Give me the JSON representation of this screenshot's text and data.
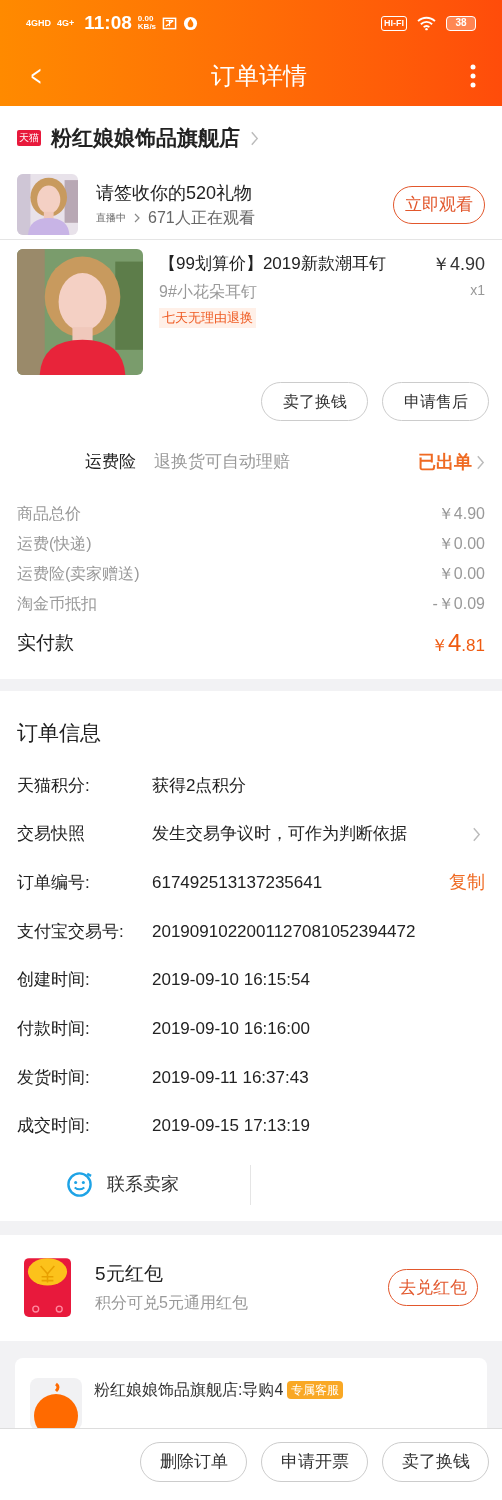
{
  "status_bar": {
    "network_1": "4GHD",
    "network_2": "4G+",
    "time": "11:08",
    "speed_value": "0.00",
    "speed_unit": "KB/s",
    "hifi": "HI-FI",
    "battery": "38"
  },
  "header": {
    "back": "<",
    "title": "订单详情"
  },
  "store": {
    "badge": "天猫",
    "name": "粉红娘娘饰品旗舰店"
  },
  "live": {
    "title": "请签收你的520礼物",
    "status": "直播中",
    "viewers": "671人正在观看",
    "button": "立即观看"
  },
  "product": {
    "title": "【99划算价】2019新款潮耳钉",
    "price": "￥4.90",
    "sku": "9#小花朵耳钉",
    "quantity": "x1",
    "tag": "七天无理由退换"
  },
  "item_actions": [
    "卖了换钱",
    "申请售后"
  ],
  "insurance": {
    "label": "运费险",
    "description": "退换货可自动理赔",
    "status": "已出单"
  },
  "costs": [
    {
      "label": "商品总价",
      "value": "￥4.90"
    },
    {
      "label": "运费(快递)",
      "value": "￥0.00"
    },
    {
      "label": "运费险(卖家赠送)",
      "value": "￥0.00"
    },
    {
      "label": "淘金币抵扣",
      "value": "-￥0.09"
    }
  ],
  "total": {
    "label": "实付款",
    "currency": "￥",
    "integer": "4",
    "decimal": ".81"
  },
  "order_info": {
    "title": "订单信息",
    "rows": [
      {
        "kind": "plain",
        "label": "天猫积分:",
        "value": "获得2点积分"
      },
      {
        "kind": "link",
        "label": "交易快照",
        "value": "发生交易争议时，可作为判断依据"
      },
      {
        "kind": "copy",
        "label": "订单编号:",
        "value": "617492513137235641",
        "action": "复制"
      },
      {
        "kind": "plain",
        "label": "支付宝交易号:",
        "value": "2019091022001127081052394472"
      },
      {
        "kind": "plain",
        "label": "创建时间:",
        "value": "2019-09-10 16:15:54"
      },
      {
        "kind": "plain",
        "label": "付款时间:",
        "value": "2019-09-10 16:16:00"
      },
      {
        "kind": "plain",
        "label": "发货时间:",
        "value": "2019-09-11 16:37:43"
      },
      {
        "kind": "plain",
        "label": "成交时间:",
        "value": "2019-09-15 17:13:19"
      }
    ],
    "contact": "联系卖家"
  },
  "red_packet": {
    "title": "5元红包",
    "subtitle": "积分可兑5元通用红包",
    "button": "去兑红包"
  },
  "service_card": {
    "name": "粉红娘娘饰品旗舰店:导购4",
    "tag": "专属客服"
  },
  "bottom_actions": [
    "删除订单",
    "申请开票",
    "卖了换钱"
  ]
}
